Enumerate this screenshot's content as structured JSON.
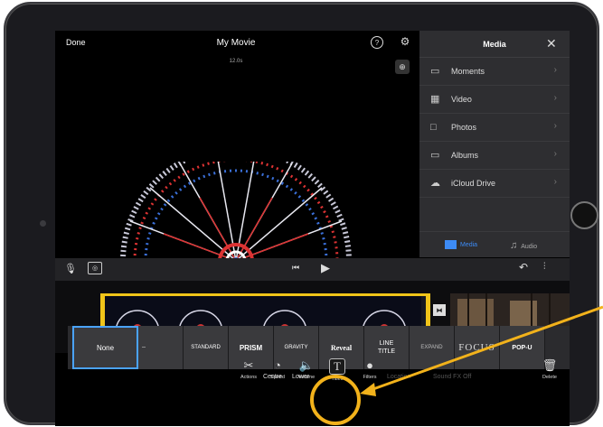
{
  "header": {
    "done": "Done",
    "title": "My Movie",
    "duration": "12.0s"
  },
  "icons": {
    "help": "help-icon",
    "settings": "gear-icon",
    "zoom": "zoom-icon"
  },
  "media_panel": {
    "title": "Media",
    "items": [
      {
        "label": "Moments",
        "icon": "moments-icon"
      },
      {
        "label": "Video",
        "icon": "film-icon"
      },
      {
        "label": "Photos",
        "icon": "photo-icon"
      },
      {
        "label": "Albums",
        "icon": "album-icon"
      },
      {
        "label": "iCloud Drive",
        "icon": "cloud-icon"
      }
    ],
    "tabs": [
      {
        "label": "Media",
        "active": true
      },
      {
        "label": "Audio",
        "active": false
      }
    ]
  },
  "title_styles": [
    "None",
    "--",
    "STANDARD",
    "PRISM",
    "GRAVITY",
    "Reveal",
    "LINE TITLE",
    "EXPAND",
    "FOCUS",
    "POP-U"
  ],
  "title_options": {
    "centre": "Centre",
    "lower": "Lower",
    "location": "Location",
    "sound": "Sound FX Off"
  },
  "toolbar": [
    {
      "label": "Actions",
      "icon": "scissors-icon"
    },
    {
      "label": "Speed",
      "icon": "speed-icon"
    },
    {
      "label": "Volume",
      "icon": "volume-icon"
    },
    {
      "label": "Titles",
      "icon": "titles-icon"
    },
    {
      "label": "Filters",
      "icon": "filters-icon"
    },
    {
      "label": "Delete",
      "icon": "trash-icon"
    }
  ],
  "colors": {
    "highlight": "#f2b21b",
    "selected": "#4aa3ff",
    "clip_border": "#f0c419",
    "accent": "#3d8bf5"
  }
}
